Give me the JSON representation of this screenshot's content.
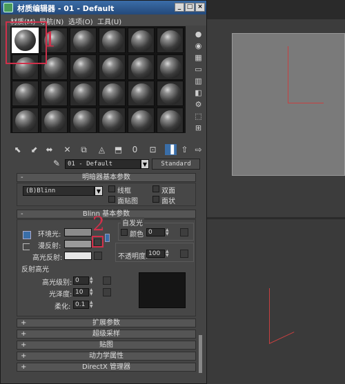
{
  "window": {
    "title": "材质编辑器 - 01 - Default",
    "buttons": {
      "minimize": "_",
      "maximize": "□",
      "close": "×"
    }
  },
  "menu": [
    {
      "label": "材质(M)"
    },
    {
      "label": "导航(N)"
    },
    {
      "label": "选项(O)"
    },
    {
      "label": "工具(U)"
    }
  ],
  "annotations": {
    "one": "1",
    "two": "2"
  },
  "material": {
    "name": "01 - Default",
    "type_button": "Standard",
    "dropdown_arrow": "▼"
  },
  "shader_rollout": {
    "title": "明暗器基本参数",
    "sign": "-",
    "shader": "(B)Blinn",
    "options": [
      {
        "label": "线框"
      },
      {
        "label": "双面"
      },
      {
        "label": "面贴图"
      },
      {
        "label": "面状"
      }
    ]
  },
  "blinn_rollout": {
    "title": "Blinn 基本参数",
    "sign": "-",
    "ambient_label": "环境光:",
    "diffuse_label": "漫反射:",
    "specular_label": "高光反射:",
    "self_illum": {
      "group_label": "自发光",
      "color_label": "颜色",
      "value": "0"
    },
    "opacity": {
      "label": "不透明度:",
      "value": "100"
    },
    "reflection_highlight": {
      "group_label": "反射高光",
      "specular_level": {
        "label": "高光级别:",
        "value": "0"
      },
      "glossiness": {
        "label": "光泽度:",
        "value": "10"
      },
      "soften": {
        "label": "柔化:",
        "value": "0.1"
      }
    },
    "colors": {
      "ambient": "#8c8c8c",
      "diffuse": "#9a9a9a",
      "specular": "#e6e6e6"
    }
  },
  "collapsed_rollouts": [
    {
      "sign": "+",
      "title": "扩展参数"
    },
    {
      "sign": "+",
      "title": "超级采样"
    },
    {
      "sign": "+",
      "title": "贴图"
    },
    {
      "sign": "+",
      "title": "动力学属性"
    },
    {
      "sign": "+",
      "title": "DirectX 管理器"
    }
  ],
  "right_toolbar_icons": [
    "sample-type-sphere-icon",
    "backlight-icon",
    "checker-background-icon",
    "sample-uv-icon",
    "video-color-check-icon",
    "make-preview-icon",
    "options-icon",
    "select-by-material-icon",
    "material-navigator-icon"
  ],
  "bottom_toolbar_icons": [
    "get-material-icon",
    "put-to-scene-icon",
    "assign-to-selection-icon",
    "reset-map-icon",
    "make-copy-icon",
    "make-unique-icon",
    "put-to-library-icon",
    "material-id-channel-icon",
    "show-map-in-viewport-icon",
    "show-end-result-icon",
    "go-to-parent-icon",
    "go-forward-icon"
  ],
  "accent_color": "#d0304a"
}
